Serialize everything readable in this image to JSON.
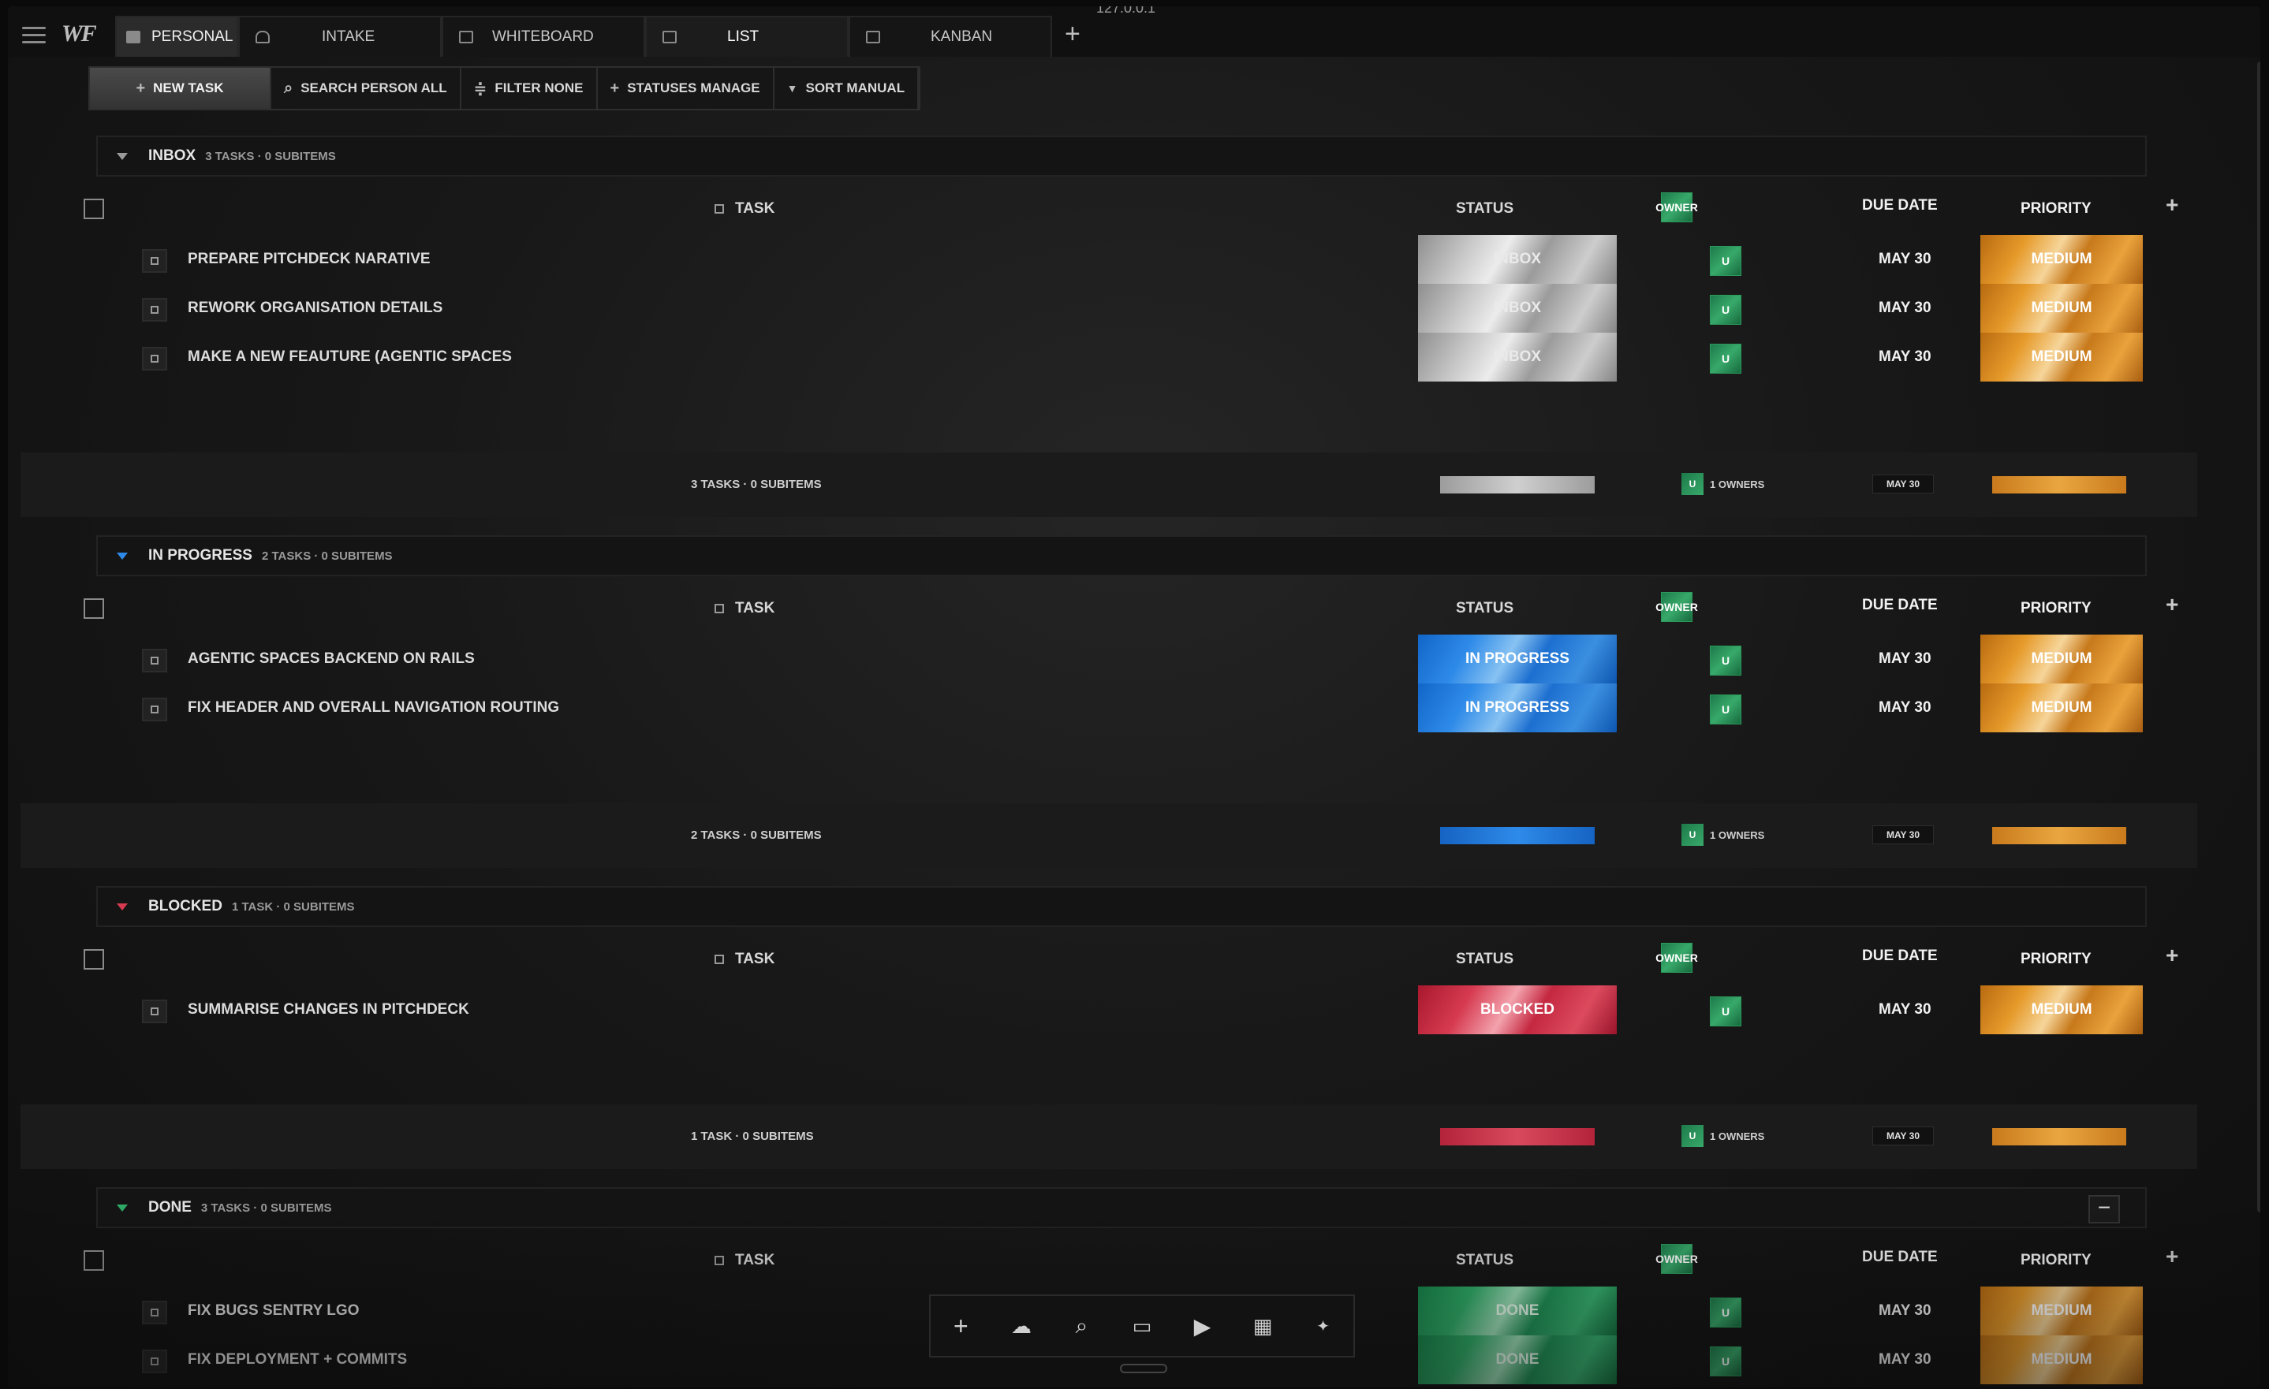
{
  "window": {
    "url": "127.0.0.1"
  },
  "topbar": {
    "logo": "WF",
    "tabs": [
      {
        "label": "PERSONAL"
      },
      {
        "label": "INTAKE"
      },
      {
        "label": "WHITEBOARD"
      },
      {
        "label": "LIST"
      },
      {
        "label": "KANBAN"
      }
    ],
    "add_tab": "+"
  },
  "toolbar": {
    "new_task": "NEW TASK",
    "search": "SEARCH PERSON ALL",
    "filter": "FILTER NONE",
    "statuses": "STATUSES MANAGE",
    "sort": "SORT MANUAL"
  },
  "columns": {
    "task": "TASK",
    "status": "STATUS",
    "owner": "OWNER",
    "due": "DUE DATE",
    "priority": "PRIORITY",
    "add": "+"
  },
  "groups": {
    "inbox": {
      "name": "INBOX",
      "meta": "3 TASKS · 0 SUBITEMS",
      "rows": [
        {
          "name": "PREPARE PITCHDECK NARATIVE",
          "status": "INBOX",
          "owner": "U",
          "due": "MAY 30",
          "priority": "MEDIUM"
        },
        {
          "name": "REWORK ORGANISATION DETAILS",
          "status": "INBOX",
          "owner": "U",
          "due": "MAY 30",
          "priority": "MEDIUM"
        },
        {
          "name": "MAKE A NEW FEAUTURE (AGENTIC SPACES",
          "status": "INBOX",
          "owner": "U",
          "due": "MAY 30",
          "priority": "MEDIUM"
        }
      ],
      "summary": {
        "text": "3 TASKS · 0 SUBITEMS",
        "owner_avatar": "U",
        "owners": "1 OWNERS",
        "due": "MAY 30"
      }
    },
    "progress": {
      "name": "IN PROGRESS",
      "meta": "2 TASKS · 0 SUBITEMS",
      "rows": [
        {
          "name": "AGENTIC SPACES BACKEND ON RAILS",
          "status": "IN PROGRESS",
          "owner": "U",
          "due": "MAY 30",
          "priority": "MEDIUM"
        },
        {
          "name": "FIX HEADER AND OVERALL NAVIGATION ROUTING",
          "status": "IN PROGRESS",
          "owner": "U",
          "due": "MAY 30",
          "priority": "MEDIUM"
        }
      ],
      "summary": {
        "text": "2 TASKS · 0 SUBITEMS",
        "owner_avatar": "U",
        "owners": "1 OWNERS",
        "due": "MAY 30"
      }
    },
    "blocked": {
      "name": "BLOCKED",
      "meta": "1 TASK · 0 SUBITEMS",
      "rows": [
        {
          "name": "SUMMARISE CHANGES IN PITCHDECK",
          "status": "BLOCKED",
          "owner": "U",
          "due": "MAY 30",
          "priority": "MEDIUM"
        }
      ],
      "summary": {
        "text": "1 TASK · 0 SUBITEMS",
        "owner_avatar": "U",
        "owners": "1 OWNERS",
        "due": "MAY 30"
      }
    },
    "done": {
      "name": "DONE",
      "meta": "3 TASKS · 0 SUBITEMS",
      "collapse": "−",
      "rows": [
        {
          "name": "FIX BUGS SENTRY LGO",
          "status": "DONE",
          "owner": "U",
          "due": "MAY 30",
          "priority": "MEDIUM"
        },
        {
          "name": "FIX DEPLOYMENT + COMMITS",
          "status": "DONE",
          "owner": "U",
          "due": "MAY 30",
          "priority": "MEDIUM"
        }
      ]
    }
  },
  "colors": {
    "inbox": "#c8c8c8",
    "in_progress": "#2e8ae8",
    "blocked": "#d63a50",
    "done": "#2fae68",
    "priority_medium": "#e69a2a",
    "owner": "#2a9a5a"
  },
  "dock": {
    "icons": [
      "plus-icon",
      "cloud-icon",
      "search-icon",
      "chat-icon",
      "play-icon",
      "grid-icon",
      "sparkle-icon"
    ]
  }
}
